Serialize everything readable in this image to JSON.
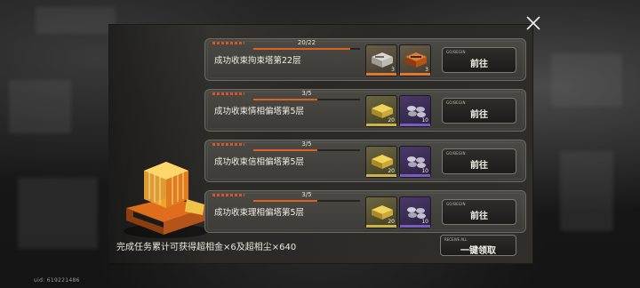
{
  "uid": "uid: 619221486",
  "colors": {
    "accent": "#e0611e",
    "panel": "#33322e",
    "gold": "#c9b54a",
    "purple": "#7a5cc0"
  },
  "tasks": [
    {
      "count": "20/22",
      "progress": 0.91,
      "title": "成功收束拘束塔第22层",
      "rewards": [
        {
          "icon": "material-stack-icon",
          "rarity": "orange",
          "qty": "3"
        },
        {
          "icon": "orange-chip-icon",
          "rarity": "orange",
          "qty": "3"
        }
      ],
      "button": {
        "tag": "GO/BEGIN",
        "label": "前往"
      }
    },
    {
      "count": "3/5",
      "progress": 0.6,
      "title": "成功收束情相偏塔第5层",
      "rewards": [
        {
          "icon": "gold-bar-icon",
          "rarity": "gold",
          "qty": "20"
        },
        {
          "icon": "dust-pile-icon",
          "rarity": "purple",
          "qty": "10"
        }
      ],
      "button": {
        "tag": "GO/BEGIN",
        "label": "前往"
      }
    },
    {
      "count": "3/5",
      "progress": 0.6,
      "title": "成功收束信相偏塔第5层",
      "rewards": [
        {
          "icon": "gold-bar-icon",
          "rarity": "gold",
          "qty": "20"
        },
        {
          "icon": "dust-pile-icon",
          "rarity": "purple",
          "qty": "10"
        }
      ],
      "button": {
        "tag": "GO/BEGIN",
        "label": "前往"
      }
    },
    {
      "count": "3/5",
      "progress": 0.6,
      "title": "成功收束理相偏塔第5层",
      "rewards": [
        {
          "icon": "gold-bar-icon",
          "rarity": "gold",
          "qty": "20"
        },
        {
          "icon": "dust-pile-icon",
          "rarity": "purple",
          "qty": "10"
        }
      ],
      "button": {
        "tag": "GO/BEGIN",
        "label": "前往"
      }
    }
  ],
  "summary": "完成任务累计可获得超相金×6及超相尘×640",
  "claim_button": {
    "tag": "RECEIVE ALL",
    "label": "一键领取"
  },
  "close_icon": "close-icon"
}
